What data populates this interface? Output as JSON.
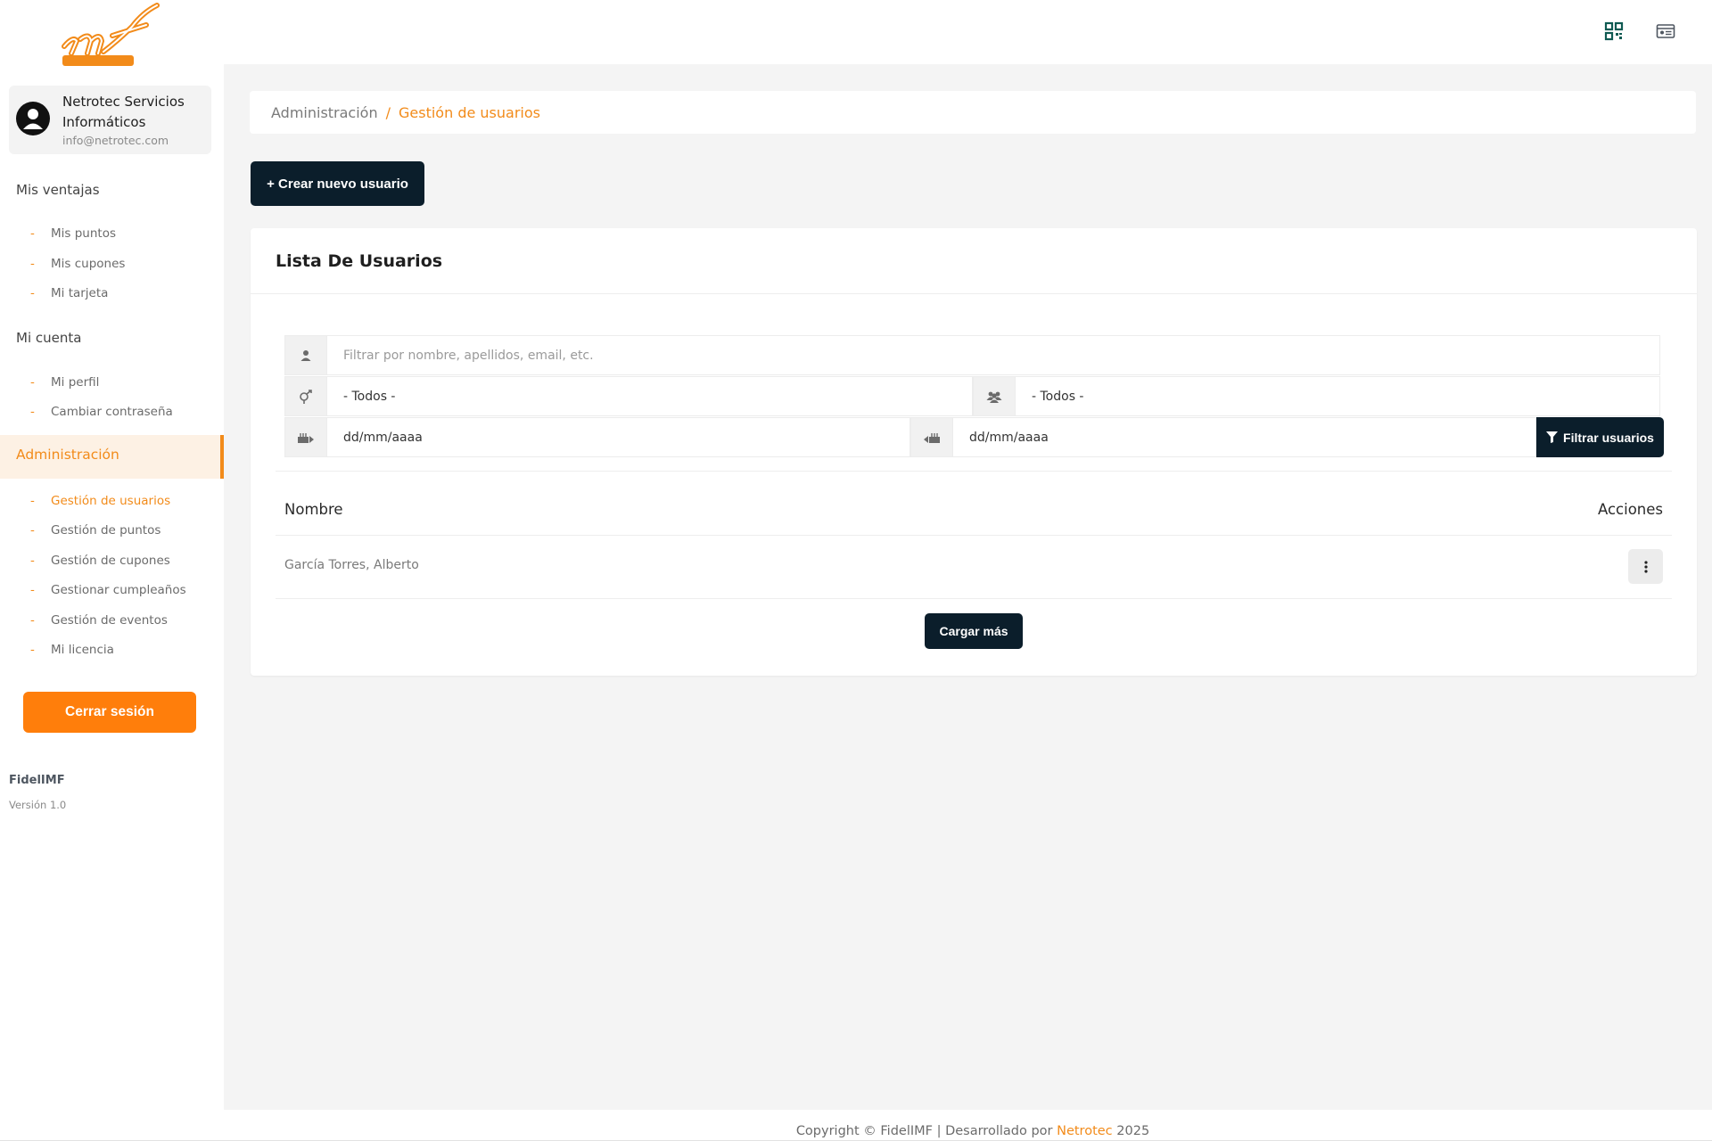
{
  "sidebar": {
    "logo_text": "imf eings",
    "profile": {
      "name": "Netrotec Servicios Informáticos",
      "email": "info@netrotec.com"
    },
    "sections": [
      {
        "label": "Mis ventajas",
        "items": [
          "Mis puntos",
          "Mis cupones",
          "Mi tarjeta"
        ]
      },
      {
        "label": "Mi cuenta",
        "items": [
          "Mi perfil",
          "Cambiar contraseña"
        ]
      },
      {
        "label": "Administración",
        "items": [
          "Gestión de usuarios",
          "Gestión de puntos",
          "Gestión de cupones",
          "Gestionar cumpleaños",
          "Gestión de eventos",
          "Mi licencia"
        ]
      }
    ],
    "dash": "-",
    "logout_label": "Cerrar sesión",
    "app_name": "FidelIMF",
    "app_version": "Versión 1.0"
  },
  "topbar": {
    "icons": [
      "qr-code-icon",
      "id-card-icon"
    ]
  },
  "breadcrumb": {
    "root": "Administración",
    "separator": "/",
    "current": "Gestión de usuarios"
  },
  "create_button": "+ Crear nuevo usuario",
  "users_card": {
    "title": "Lista De Usuarios",
    "filters": {
      "search_placeholder": "Filtrar por nombre, apellidos, email, etc.",
      "gender_value": "- Todos -",
      "group_value": "- Todos -",
      "date_from": "dd/mm/aaaa",
      "date_to": "dd/mm/aaaa",
      "filter_button": "Filtrar usuarios"
    },
    "columns": {
      "name": "Nombre",
      "actions": "Acciones"
    },
    "rows": [
      {
        "name": "García Torres, Alberto"
      }
    ],
    "load_more": "Cargar más"
  },
  "footer": {
    "prefix": "Copyright © FidelIMF | Desarrollado por",
    "brand": "Netrotec",
    "year": "2025"
  },
  "colors": {
    "accent": "#f28b1a",
    "dark": "#0b1e2b",
    "logout": "#ff7e0b",
    "background": "#f4f4f4"
  }
}
